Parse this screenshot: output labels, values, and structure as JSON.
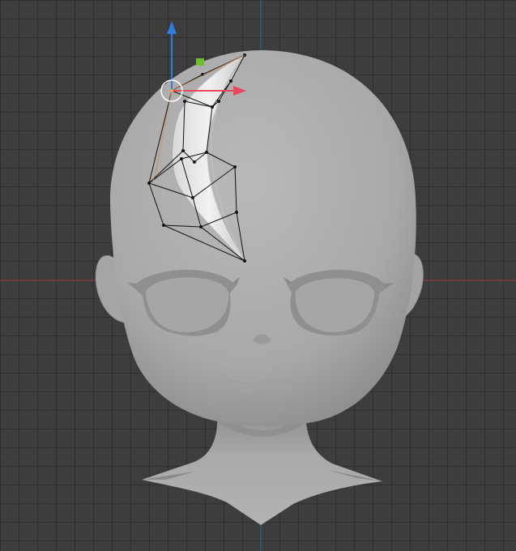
{
  "viewport": {
    "background": "#3d3d3d",
    "grid_color": "#2f2f2f",
    "x_axis_color": "#a0434c",
    "y_axis_color": "#3a6ea5"
  },
  "model": {
    "skin_color": "#a9a9a9",
    "shadow_color": "#7f7f7f"
  },
  "gizmo": {
    "up_arrow_color": "#2f7de1",
    "right_arrow_color": "#e8465a",
    "corner_handle_color": "#6fbf2e",
    "pivot": "circle-pivot-icon"
  },
  "selection": {
    "type": "lattice-cage",
    "wire_color": "#111111",
    "highlight_color": "#e9e9e9"
  }
}
